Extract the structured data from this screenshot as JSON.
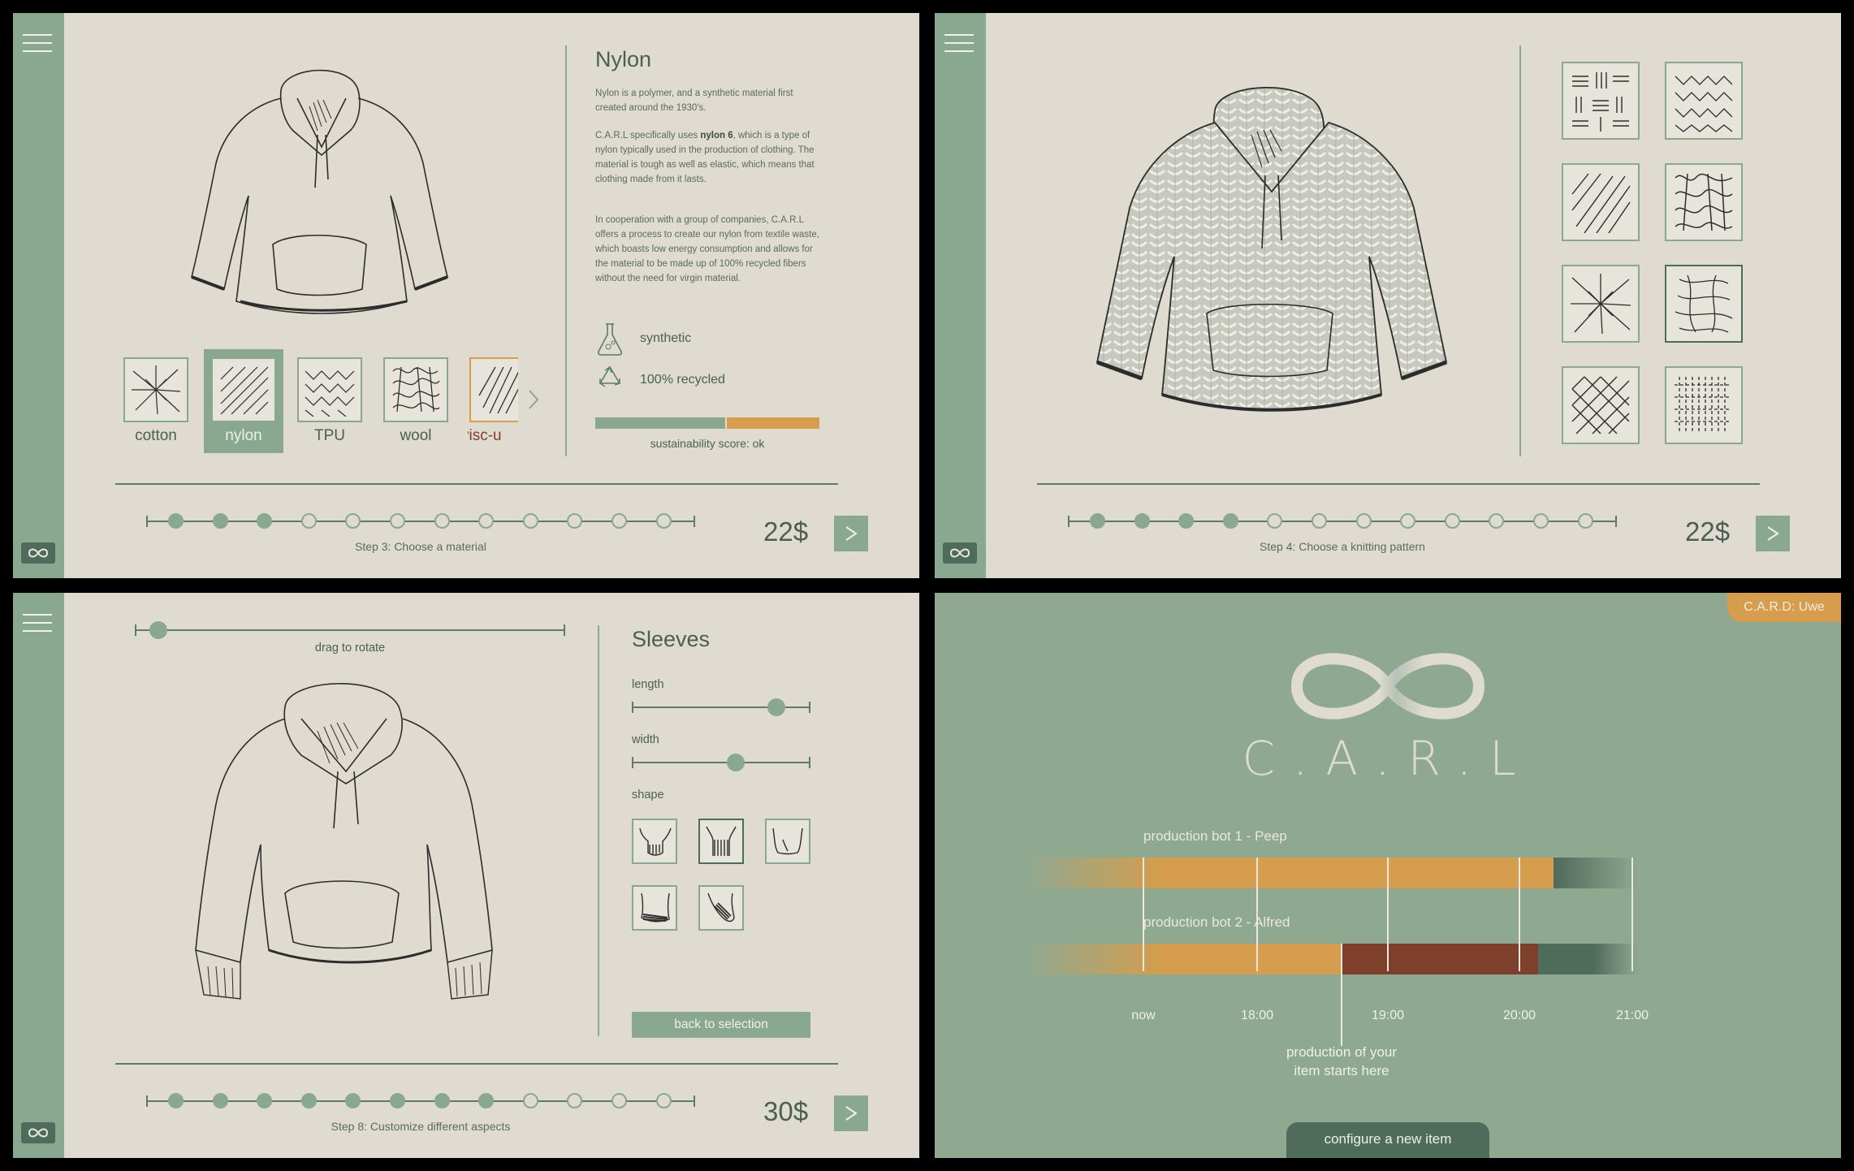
{
  "material_screen": {
    "title": "Nylon",
    "paragraphs": [
      "Nylon is a polymer, and a synthetic material first created around the 1930's.",
      "C.A.R.L specifically uses",
      "nylon 6",
      ", which is a type of nylon typically used in the production of clothing. The material is tough as well as elastic, which means that clothing made from it lasts.",
      "In cooperation with a group of companies, C.A.R.L offers a process to create our nylon from textile waste, which boasts low energy consumption and allows for the material to be made up of 100% recycled fibers without the need for virgin material."
    ],
    "properties": [
      "synthetic",
      "100% recycled"
    ],
    "sustainability_label": "sustainability score: ok",
    "sustainability_score_fraction": 0.58,
    "materials": [
      "cotton",
      "nylon",
      "TPU",
      "wool",
      "visc-u"
    ],
    "selected_material": "nylon",
    "step_label": "Step 3: Choose a material",
    "price": "22$",
    "steps_total": 12,
    "steps_done": 3
  },
  "pattern_screen": {
    "step_label": "Step 4: Choose a knitting pattern",
    "price": "22$",
    "steps_total": 12,
    "steps_done": 4
  },
  "customize_screen": {
    "rotate_label": "drag to rotate",
    "title": "Sleeves",
    "length_label": "length",
    "width_label": "width",
    "shape_label": "shape",
    "length_value_fraction": 0.81,
    "width_value_fraction": 0.58,
    "back_label": "back to selection",
    "step_label": "Step 8: Customize different aspects",
    "price": "30$",
    "steps_total": 12,
    "steps_done": 8
  },
  "schedule_screen": {
    "card_tag": "C.A.R.D: Uwe",
    "brand": "C.A.R.L",
    "bot1": "production bot 1 - Peep",
    "bot2": "production bot 2 - Alfred",
    "times": [
      "now",
      "18:00",
      "19:00",
      "20:00",
      "21:00"
    ],
    "note_line1": "production of your",
    "note_line2": "item starts here",
    "configure_label": "configure a new item"
  },
  "colors": {
    "sage": "#8aa88f",
    "dark_green": "#4f6b5c",
    "paper": "#dfdbd0",
    "orange": "#d59d4d",
    "rust": "#7f3f2d"
  }
}
